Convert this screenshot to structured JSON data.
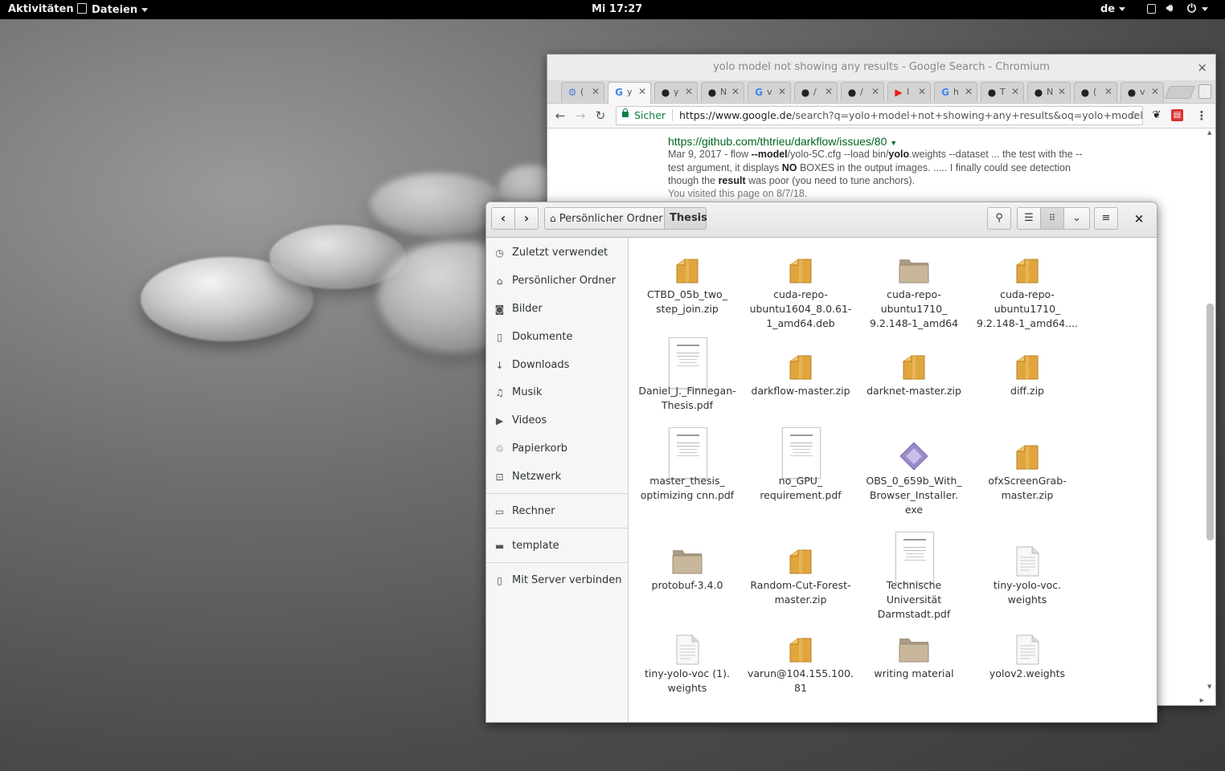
{
  "topbar": {
    "activities": "Aktivitäten",
    "app_menu": "Dateien",
    "clock": "Mi 17:27",
    "keyboard_layout": "de"
  },
  "chromium": {
    "window_title": "yolo model not showing any results - Google Search - Chromium",
    "close": "×",
    "tabs": [
      {
        "icon": "chromium-icon",
        "label": "(",
        "color": "#4a7fd6"
      },
      {
        "icon": "google-icon",
        "label": "y",
        "color": "#4285f4"
      },
      {
        "icon": "github-icon",
        "label": "y",
        "color": "#222"
      },
      {
        "icon": "github-icon",
        "label": "N",
        "color": "#222"
      },
      {
        "icon": "google-icon",
        "label": "v",
        "color": "#4285f4"
      },
      {
        "icon": "github-icon",
        "label": "/",
        "color": "#222"
      },
      {
        "icon": "github-icon",
        "label": "/",
        "color": "#222"
      },
      {
        "icon": "youtube-icon",
        "label": "I",
        "color": "#e62117"
      },
      {
        "icon": "google-icon",
        "label": "h",
        "color": "#4285f4"
      },
      {
        "icon": "github-icon",
        "label": "T",
        "color": "#222"
      },
      {
        "icon": "github-icon",
        "label": "N",
        "color": "#222"
      },
      {
        "icon": "github-icon",
        "label": "(",
        "color": "#222"
      },
      {
        "icon": "github-icon",
        "label": "v",
        "color": "#222"
      }
    ],
    "security": "Sicher",
    "url_host": "https://www.google.de",
    "url_rest": "/search?q=yolo+model+not+showing+any+results&oq=yolo+model+n...",
    "result": {
      "cite": "https://github.com/thtrieu/darkflow/issues/80",
      "snippet_1": "Mar 9, 2017 - flow ",
      "snippet_b1": "--model",
      "snippet_2": "/yolo-5C.cfg --load bin/",
      "snippet_b2": "yolo",
      "snippet_3": ".weights --dataset ... the test with the --test argument, it displays ",
      "snippet_b3": "NO",
      "snippet_4": " BOXES in the output images. ..... I finally could see detection though the ",
      "snippet_b4": "result",
      "snippet_5": " was poor (you need to tune anchors).",
      "visited": "You visited this page on 8/7/18."
    }
  },
  "files": {
    "breadcrumb_home": "Persönlicher Ordner",
    "breadcrumb_current": "Thesis",
    "sidebar": [
      {
        "icon": "clock-icon",
        "label": "Zuletzt verwendet"
      },
      {
        "icon": "home-icon",
        "label": "Persönlicher Ordner"
      },
      {
        "icon": "camera-icon",
        "label": "Bilder"
      },
      {
        "icon": "document-icon",
        "label": "Dokumente"
      },
      {
        "icon": "download-icon",
        "label": "Downloads"
      },
      {
        "icon": "music-icon",
        "label": "Musik"
      },
      {
        "icon": "video-icon",
        "label": "Videos"
      },
      {
        "icon": "trash-icon",
        "label": "Papierkorb"
      },
      {
        "icon": "network-icon",
        "label": "Netzwerk"
      },
      {
        "icon": "computer-icon",
        "label": "Rechner"
      },
      {
        "icon": "folder-icon",
        "label": "template"
      },
      {
        "icon": "server-icon",
        "label": "Mit Server verbinden"
      }
    ],
    "items": [
      {
        "type": "package",
        "lines": [
          "CTBD_05b_two_",
          "step_join.zip"
        ]
      },
      {
        "type": "package",
        "lines": [
          "cuda-repo-",
          "ubuntu1604_8.0.61-",
          "1_amd64.deb"
        ]
      },
      {
        "type": "folder",
        "lines": [
          "cuda-repo-",
          "ubuntu1710_",
          "9.2.148-1_amd64"
        ]
      },
      {
        "type": "package",
        "lines": [
          "cuda-repo-",
          "ubuntu1710_",
          "9.2.148-1_amd64...."
        ]
      },
      {
        "type": "pdf",
        "lines": [
          "Daniel_J._Finnegan-",
          "Thesis.pdf"
        ]
      },
      {
        "type": "package",
        "lines": [
          "darkflow-master.zip"
        ]
      },
      {
        "type": "package",
        "lines": [
          "darknet-master.zip"
        ]
      },
      {
        "type": "package",
        "lines": [
          "diff.zip"
        ]
      },
      {
        "type": "pdf",
        "lines": [
          "master_thesis_",
          "optimizing cnn.pdf"
        ]
      },
      {
        "type": "pdf",
        "lines": [
          "no_GPU_",
          "requirement.pdf"
        ]
      },
      {
        "type": "exe",
        "lines": [
          "OBS_0_659b_With_",
          "Browser_Installer.",
          "exe"
        ]
      },
      {
        "type": "package",
        "lines": [
          "ofxScreenGrab-",
          "master.zip"
        ]
      },
      {
        "type": "folder",
        "lines": [
          "protobuf-3.4.0"
        ]
      },
      {
        "type": "package",
        "lines": [
          "Random-Cut-Forest-",
          "master.zip"
        ]
      },
      {
        "type": "pdf",
        "lines": [
          "Technische",
          "Universität",
          "Darmstadt.pdf"
        ]
      },
      {
        "type": "text",
        "lines": [
          "tiny-yolo-voc.",
          "weights"
        ]
      },
      {
        "type": "text",
        "lines": [
          "tiny-yolo-voc (1).",
          "weights"
        ]
      },
      {
        "type": "package",
        "lines": [
          "varun@104.155.100.",
          "81"
        ]
      },
      {
        "type": "folder",
        "lines": [
          "writing material"
        ]
      },
      {
        "type": "text",
        "lines": [
          "yolov2.weights"
        ]
      },
      {
        "type": "text",
        "lines": []
      },
      {
        "type": "text",
        "lines": []
      }
    ]
  },
  "colors": {
    "package": "#e0a63e",
    "folder": "#c9b79c",
    "exe": "#9b8bc8",
    "accent": "#0b8043"
  }
}
